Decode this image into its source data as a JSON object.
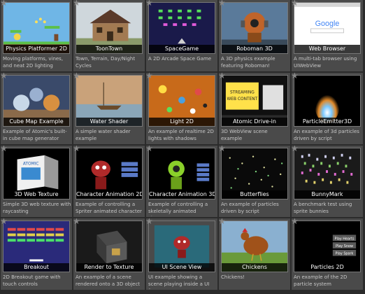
{
  "examples": [
    {
      "title": "Physics Platformer 2D",
      "desc": "Moving platforms, vines, and neat 2D lighting",
      "icon": "platformer-thumb"
    },
    {
      "title": "ToonTown",
      "desc": "Town, Terrain, Day/Night Cycles",
      "icon": "toontown-thumb"
    },
    {
      "title": "SpaceGame",
      "desc": "A 2D Arcade Space Game",
      "icon": "spacegame-thumb"
    },
    {
      "title": "Roboman 3D",
      "desc": "A 3D physics example featuring Roboman!",
      "icon": "roboman-thumb"
    },
    {
      "title": "Web Browser",
      "desc": "A multi-tab browser using UIWebView",
      "icon": "browser-thumb"
    },
    {
      "title": "Cube Map Example",
      "desc": "Example of Atomic's built-in cube map generator",
      "icon": "cubemap-thumb"
    },
    {
      "title": "Water Shader",
      "desc": "A simple water shader example",
      "icon": "water-thumb"
    },
    {
      "title": "Light 2D",
      "desc": "An example of realtime 2D lights with shadows",
      "icon": "light2d-thumb"
    },
    {
      "title": "Atomic Drive-in",
      "desc": "3D WebView scene example",
      "icon": "drivein-thumb"
    },
    {
      "title": "ParticleEmitter3D",
      "desc": "An example of 3d particles driven by script",
      "icon": "particle3d-thumb"
    },
    {
      "title": "3D Web Texture",
      "desc": "Simple 3D web texture with raycasting",
      "icon": "webtexture-thumb"
    },
    {
      "title": "Character Animation 2D",
      "desc": "Example of controlling a Spriter animated character",
      "icon": "charanim2d-thumb"
    },
    {
      "title": "Character Animation 3D",
      "desc": "Example of controlling a skeletally animated character",
      "icon": "charanim3d-thumb"
    },
    {
      "title": "Butterflies",
      "desc": "An example of particles driven by script",
      "icon": "butterflies-thumb"
    },
    {
      "title": "BunnyMark",
      "desc": "A benchmark test using sprite bunnies",
      "icon": "bunnymark-thumb"
    },
    {
      "title": "Breakout",
      "desc": "2D Breakout game with touch controls",
      "icon": "breakout-thumb"
    },
    {
      "title": "Render to Texture",
      "desc": "An example of a scene rendered onto a 3D object",
      "icon": "rendertex-thumb"
    },
    {
      "title": "UI Scene View",
      "desc": "UI example showing a scene playing inside a UI frame",
      "icon": "uiscene-thumb"
    },
    {
      "title": "Chickens",
      "desc": "Chickens!",
      "icon": "chickens-thumb"
    },
    {
      "title": "Particles 2D",
      "desc": "An example of the 2D particle system",
      "icon": "particles2d-thumb"
    }
  ],
  "thumb_text": {
    "google": "Google",
    "drivein_1": "STREAMING",
    "drivein_2": "WEB CONTENT",
    "atomic": "ATOMIC",
    "play_hearts": "Play Hearts",
    "play_snow": "Play Snow",
    "play_spark": "Play Spark"
  },
  "colors": {
    "card_bg": "#4a4a4a",
    "page_bg": "#2b2b2b",
    "caption_bg": "#000000",
    "desc_text": "#c8c8c8"
  }
}
